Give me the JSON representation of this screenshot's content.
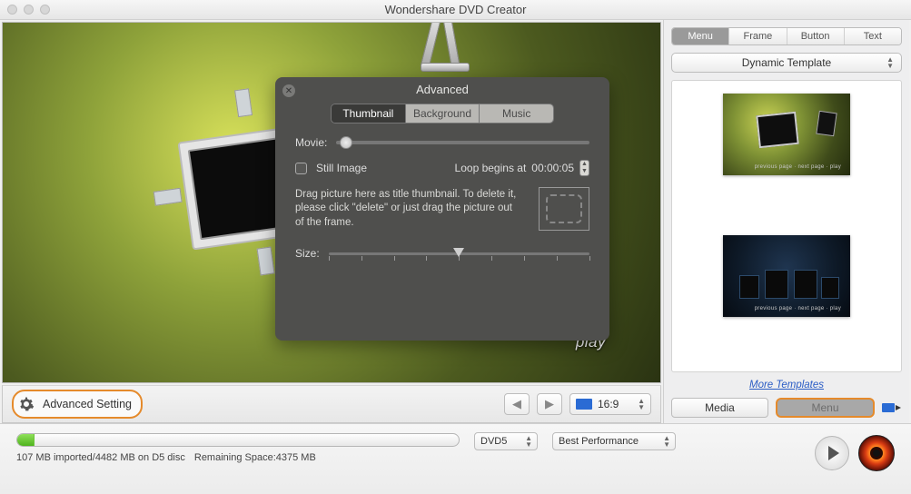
{
  "window": {
    "title": "Wondershare DVD Creator"
  },
  "preview": {
    "play_label": "play"
  },
  "popup": {
    "title": "Advanced",
    "tabs": {
      "thumbnail": "Thumbnail",
      "background": "Background",
      "music": "Music"
    },
    "movie_label": "Movie:",
    "still_image_label": "Still Image",
    "loop_label": "Loop begins at",
    "loop_value": "00:00:05",
    "drop_text": "Drag picture here as title thumbnail. To delete it, please click \"delete\" or just drag the picture out of the frame.",
    "size_label": "Size:"
  },
  "preview_bar": {
    "advanced_setting": "Advanced Setting",
    "aspect": "16:9"
  },
  "sidebar": {
    "tabs": {
      "menu": "Menu",
      "frame": "Frame",
      "button": "Button",
      "text": "Text"
    },
    "template_select": "Dynamic Template",
    "more_templates": "More Templates",
    "bottom": {
      "media": "Media",
      "menu": "Menu"
    }
  },
  "footer": {
    "disc_select": "DVD5",
    "quality_select": "Best Performance",
    "imported_text": "107 MB imported/4482 MB on D5 disc",
    "remaining_text": "Remaining Space:4375 MB"
  }
}
